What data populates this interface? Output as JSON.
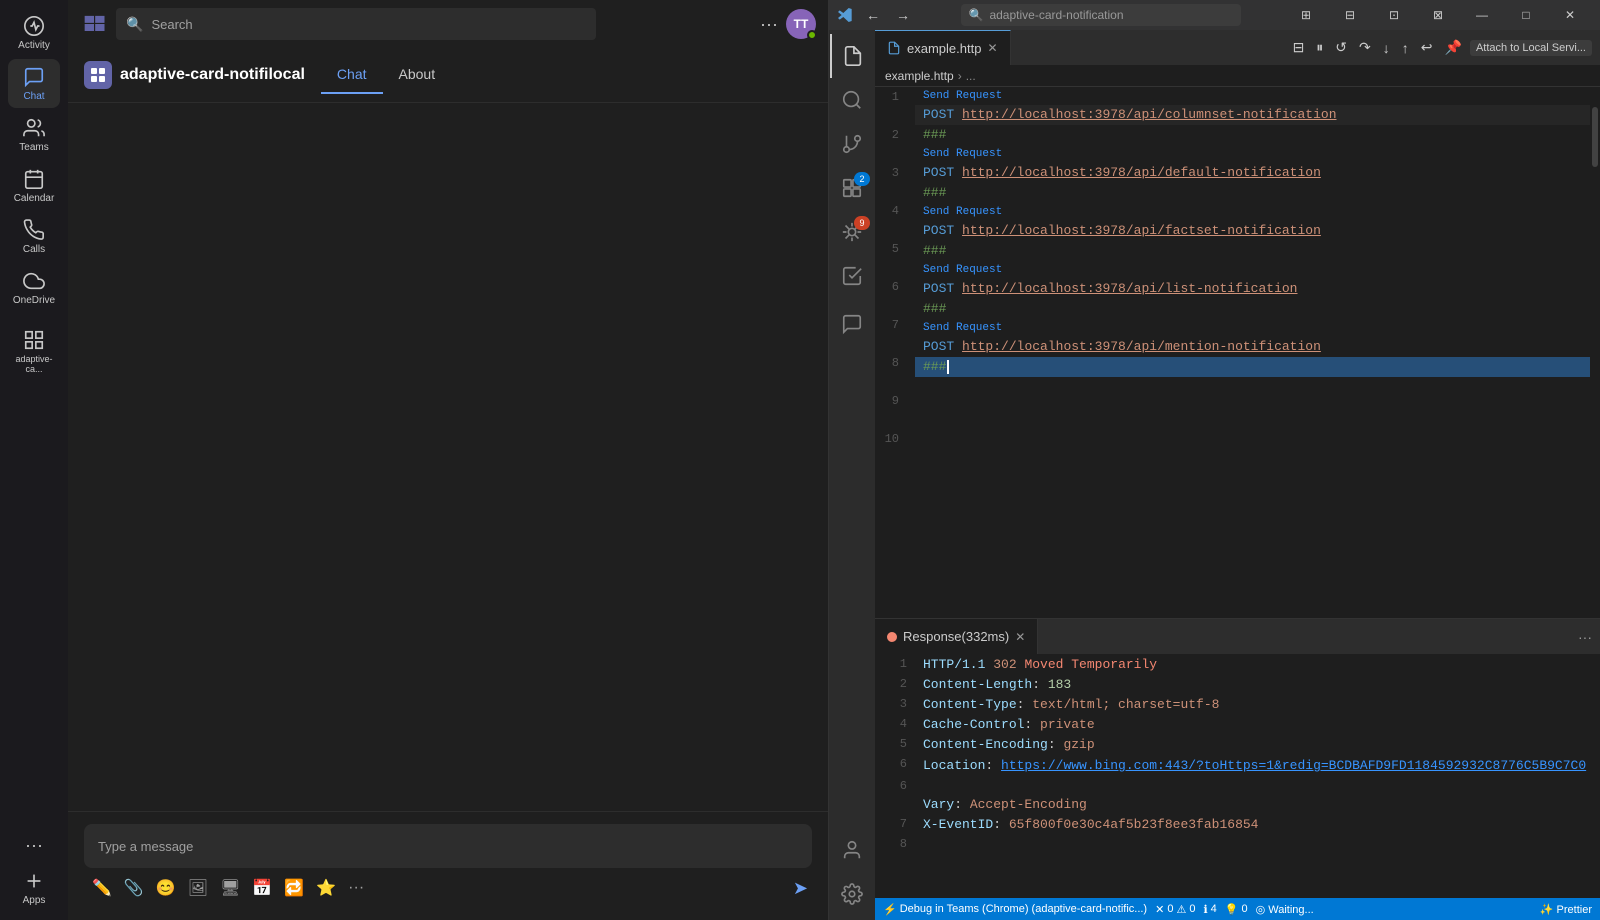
{
  "teams": {
    "title": "Microsoft Teams",
    "search_placeholder": "Search",
    "avatar_initials": "TT",
    "app_name": "adaptive-card-notifilocal",
    "tabs": [
      {
        "label": "Chat",
        "active": true
      },
      {
        "label": "About",
        "active": false
      }
    ],
    "chat_placeholder": "Type a message",
    "sidebar_items": [
      {
        "label": "Activity",
        "icon": "🔔"
      },
      {
        "label": "Chat",
        "icon": "💬",
        "active": true
      },
      {
        "label": "Teams",
        "icon": "👥"
      },
      {
        "label": "Calendar",
        "icon": "📅"
      },
      {
        "label": "Calls",
        "icon": "📞"
      },
      {
        "label": "OneDrive",
        "icon": "☁"
      },
      {
        "label": "adaptive-ca...",
        "icon": "🧩",
        "bottom": true
      }
    ]
  },
  "vscode": {
    "title": "adaptive-card-notification",
    "tab_filename": "example.http",
    "breadcrumb": [
      "example.http",
      "..."
    ],
    "editor_lines": [
      {
        "num": 1,
        "type": "code",
        "method": "POST",
        "url": "http://localhost:3978/api/columnset-notification",
        "send_request_above": true
      },
      {
        "num": 2,
        "type": "comment",
        "text": "###"
      },
      {
        "num": 3,
        "type": "code",
        "method": "POST",
        "url": "http://localhost:3978/api/default-notification",
        "send_request_above": true
      },
      {
        "num": 4,
        "type": "comment",
        "text": "###"
      },
      {
        "num": 5,
        "type": "code",
        "method": "POST",
        "url": "http://localhost:3978/api/factset-notification",
        "send_request_above": true
      },
      {
        "num": 6,
        "type": "comment",
        "text": "###"
      },
      {
        "num": 7,
        "type": "code",
        "method": "POST",
        "url": "http://localhost:3978/api/list-notification",
        "send_request_above": true
      },
      {
        "num": 8,
        "type": "comment",
        "text": "###"
      },
      {
        "num": 9,
        "type": "code",
        "method": "POST",
        "url": "http://localhost:3978/api/mention-notification",
        "send_request_above": true
      },
      {
        "num": 10,
        "type": "comment",
        "text": "###",
        "cursor": true
      }
    ],
    "response": {
      "tab_label": "Response(332ms)",
      "lines": [
        {
          "num": 1,
          "text": "HTTP/1.1 302 Moved Temporarily"
        },
        {
          "num": 2,
          "key": "Content-Length",
          "value": "183"
        },
        {
          "num": 3,
          "key": "Content-Type",
          "value": "text/html; charset=utf-8"
        },
        {
          "num": 4,
          "key": "Cache-Control",
          "value": "private"
        },
        {
          "num": 5,
          "key": "Content-Encoding",
          "value": "gzip"
        },
        {
          "num": 6,
          "key": "Location",
          "value": "https://www.bing.com:443/?toHttps=1&redig=BCDBAFD9FD1184592932C8776C5B9C7C0"
        },
        {
          "num": 7,
          "key": "Vary",
          "value": "Accept-Encoding"
        },
        {
          "num": 8,
          "key": "X-EventID",
          "value": "65f800f0e30c4af5b23f8ee3fab16854"
        }
      ]
    },
    "statusbar": {
      "left_items": [
        "⚡ Debug in Teams (Chrome) (adaptive-card-notific...)",
        "◎ Waiting..."
      ],
      "right_item": "✨ Prettier"
    }
  }
}
